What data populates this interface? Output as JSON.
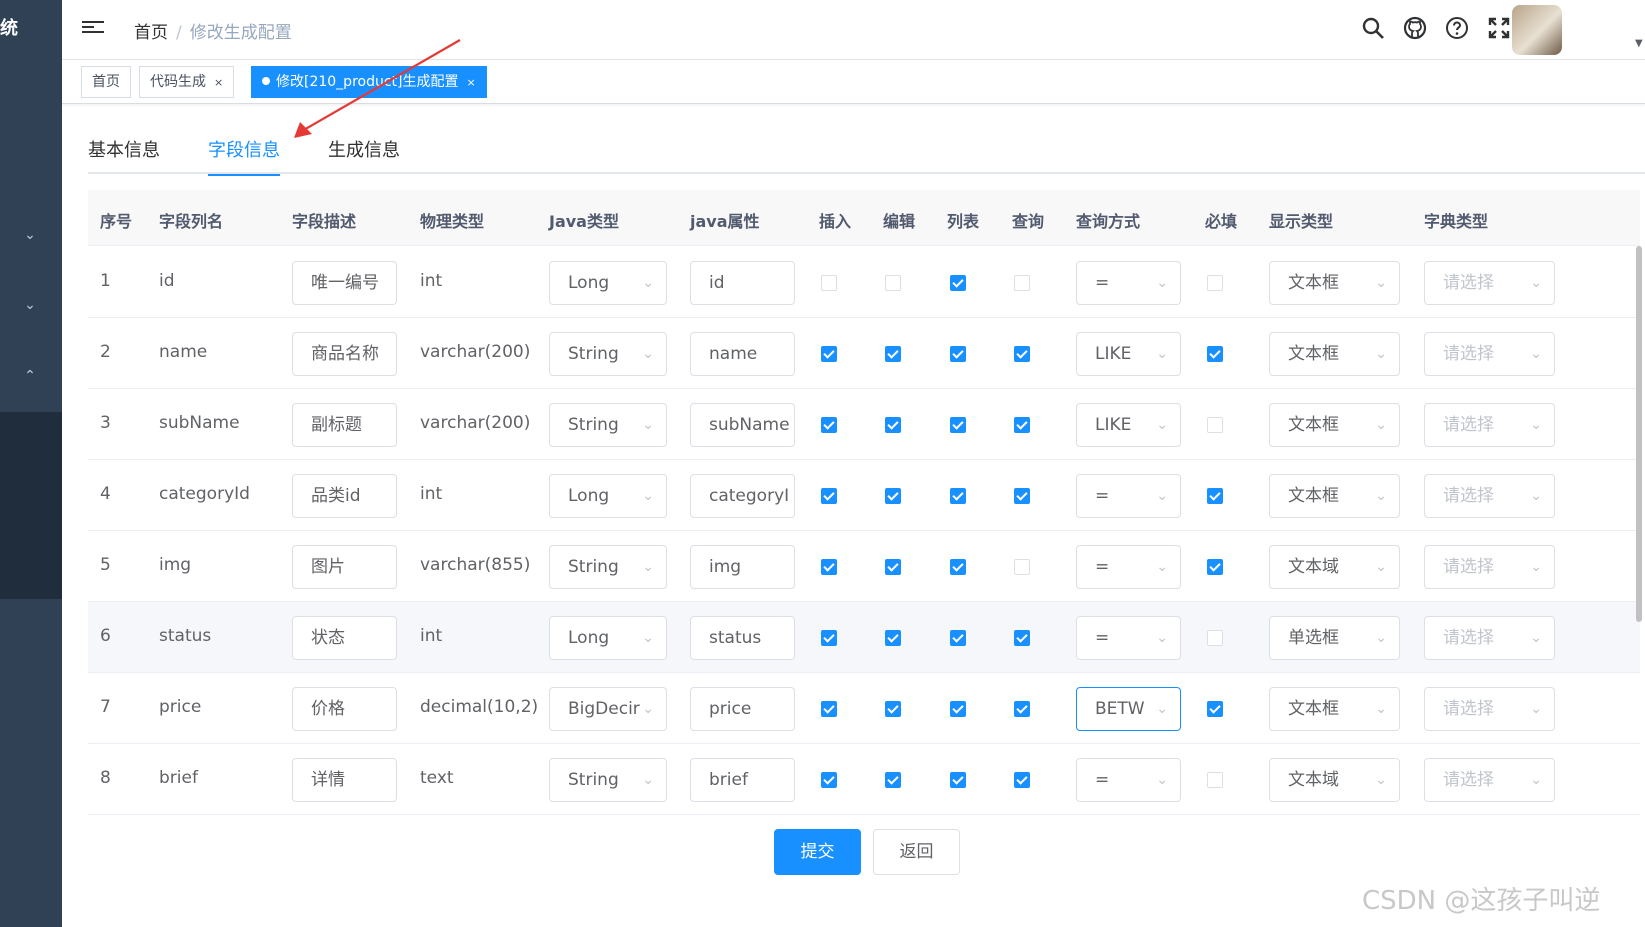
{
  "sidebar": {
    "logo_text": "统"
  },
  "breadcrumb": {
    "home": "首页",
    "separator": "/",
    "current": "修改生成配置"
  },
  "tags": [
    {
      "label": "首页"
    },
    {
      "label": "代码生成",
      "close": "×"
    },
    {
      "label": "修改[210_product]生成配置",
      "close": "×"
    }
  ],
  "tabs": [
    "基本信息",
    "字段信息",
    "生成信息"
  ],
  "table": {
    "headers": [
      "序号",
      "字段列名",
      "字段描述",
      "物理类型",
      "Java类型",
      "java属性",
      "插入",
      "编辑",
      "列表",
      "查询",
      "查询方式",
      "必填",
      "显示类型",
      "字典类型"
    ],
    "rows": [
      {
        "seq": "1",
        "column": "id",
        "desc": "唯一编号",
        "phys": "int",
        "javaType": "Long",
        "javaField": "id",
        "insert": false,
        "edit": false,
        "list": true,
        "query": false,
        "queryType": "=",
        "required": false,
        "htmlType": "文本框",
        "dict": "请选择"
      },
      {
        "seq": "2",
        "column": "name",
        "desc": "商品名称",
        "phys": "varchar(200)",
        "javaType": "String",
        "javaField": "name",
        "insert": true,
        "edit": true,
        "list": true,
        "query": true,
        "queryType": "LIKE",
        "required": true,
        "htmlType": "文本框",
        "dict": "请选择"
      },
      {
        "seq": "3",
        "column": "subName",
        "desc": "副标题",
        "phys": "varchar(200)",
        "javaType": "String",
        "javaField": "subName",
        "insert": true,
        "edit": true,
        "list": true,
        "query": true,
        "queryType": "LIKE",
        "required": false,
        "htmlType": "文本框",
        "dict": "请选择"
      },
      {
        "seq": "4",
        "column": "categoryId",
        "desc": "品类id",
        "phys": "int",
        "javaType": "Long",
        "javaField": "categoryI",
        "insert": true,
        "edit": true,
        "list": true,
        "query": true,
        "queryType": "=",
        "required": true,
        "htmlType": "文本框",
        "dict": "请选择"
      },
      {
        "seq": "5",
        "column": "img",
        "desc": "图片",
        "phys": "varchar(855)",
        "javaType": "String",
        "javaField": "img",
        "insert": true,
        "edit": true,
        "list": true,
        "query": false,
        "queryType": "=",
        "required": true,
        "htmlType": "文本域",
        "dict": "请选择"
      },
      {
        "seq": "6",
        "column": "status",
        "desc": "状态",
        "phys": "int",
        "javaType": "Long",
        "javaField": "status",
        "insert": true,
        "edit": true,
        "list": true,
        "query": true,
        "queryType": "=",
        "required": false,
        "htmlType": "单选框",
        "dict": "请选择"
      },
      {
        "seq": "7",
        "column": "price",
        "desc": "价格",
        "phys": "decimal(10,2)",
        "javaType": "BigDecir",
        "javaField": "price",
        "insert": true,
        "edit": true,
        "list": true,
        "query": true,
        "queryType": "BETW",
        "required": true,
        "htmlType": "文本框",
        "dict": "请选择"
      },
      {
        "seq": "8",
        "column": "brief",
        "desc": "详情",
        "phys": "text",
        "javaType": "String",
        "javaField": "brief",
        "insert": true,
        "edit": true,
        "list": true,
        "query": true,
        "queryType": "=",
        "required": false,
        "htmlType": "文本域",
        "dict": "请选择"
      }
    ]
  },
  "buttons": {
    "submit": "提交",
    "back": "返回"
  },
  "watermark": "CSDN @这孩子叫逆",
  "colors": {
    "primary": "#1890ff",
    "sidebar": "#304156"
  }
}
